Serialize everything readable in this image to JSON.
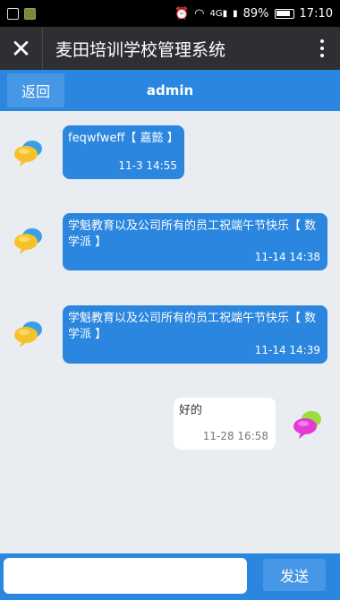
{
  "status_bar": {
    "battery": "89%",
    "time": "17:10",
    "icons": [
      "image-icon",
      "notification-icon",
      "alarm-icon",
      "wifi-icon",
      "signal-4g-icon",
      "signal-icon",
      "battery-icon"
    ]
  },
  "app": {
    "title": "麦田培训学校管理系统"
  },
  "header": {
    "back_label": "返回",
    "title": "admin"
  },
  "messages": [
    {
      "side": "left",
      "text": "feqwfweff【 嘉懿 】",
      "time": "11-3 14:55"
    },
    {
      "side": "left",
      "text": "学魁教育以及公司所有的员工祝端午节快乐【 数学派 】",
      "time": "11-14 14:38"
    },
    {
      "side": "left",
      "text": "学魁教育以及公司所有的员工祝端午节快乐【 数学派 】",
      "time": "11-14 14:39"
    },
    {
      "side": "right",
      "text": "好的",
      "time": "11-28 16:58"
    }
  ],
  "composer": {
    "value": "",
    "send_label": "发送"
  },
  "colors": {
    "header_blue": "#2a86de",
    "titlebar": "#2d2f33",
    "background": "#e9edf2"
  }
}
